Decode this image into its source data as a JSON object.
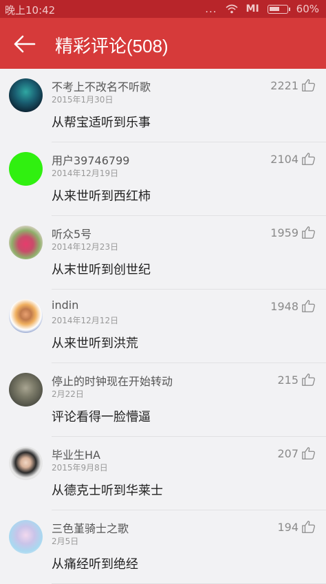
{
  "status_bar": {
    "time": "晚上10:42",
    "dots": "...",
    "carrier": "MI",
    "battery": "60%"
  },
  "header": {
    "title": "精彩评论(508)"
  },
  "comments": [
    {
      "user": "不考上不改名不听歌",
      "date": "2015年1月30日",
      "text": "从帮宝适听到乐事",
      "likes": "2221"
    },
    {
      "user": "用户39746799",
      "date": "2014年12月19日",
      "text": "从来世听到西红柿",
      "likes": "2104"
    },
    {
      "user": "听众5号",
      "date": "2014年12月23日",
      "text": "从末世听到创世纪",
      "likes": "1959"
    },
    {
      "user": "indin",
      "date": "2014年12月12日",
      "text": "从来世听到洪荒",
      "likes": "1948"
    },
    {
      "user": "停止的时钟现在开始转动",
      "date": "2月22日",
      "text": "评论看得一脸懵逼",
      "likes": "215"
    },
    {
      "user": "毕业生HA",
      "date": "2015年9月8日",
      "text": "从德克士听到华莱士",
      "likes": "207"
    },
    {
      "user": "三色堇骑士之歌",
      "date": "2月5日",
      "text": "从痛经听到绝经",
      "likes": "194"
    }
  ]
}
